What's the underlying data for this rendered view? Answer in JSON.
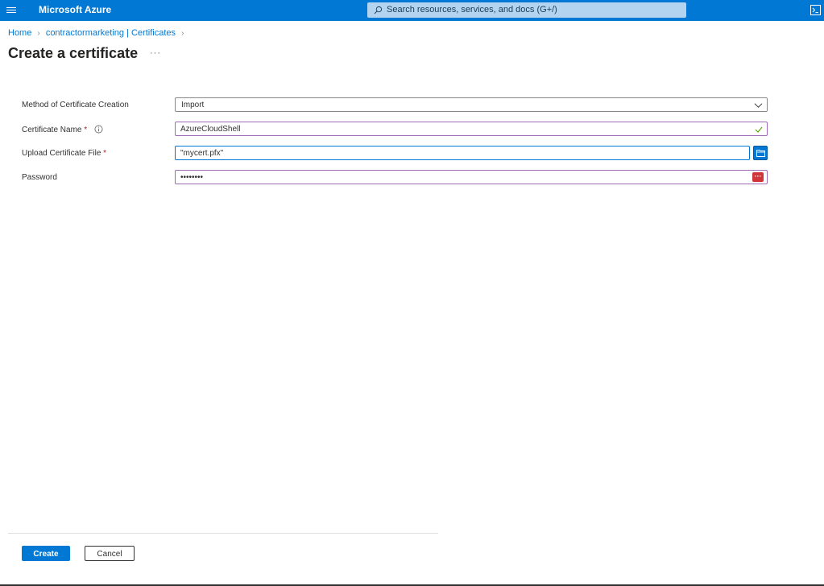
{
  "topbar": {
    "brand": "Microsoft Azure",
    "search_placeholder": "Search resources, services, and docs (G+/)",
    "color": "#0078d4"
  },
  "breadcrumb": {
    "home": "Home",
    "parent": "contractormarketing | Certificates"
  },
  "page": {
    "title": "Create a certificate",
    "more": "···"
  },
  "form": {
    "method": {
      "label": "Method of Certificate Creation",
      "value": "Import"
    },
    "name": {
      "label": "Certificate Name",
      "required_mark": "*",
      "value": "AzureCloudShell"
    },
    "upload": {
      "label": "Upload Certificate File",
      "required_mark": "*",
      "value": "\"mycert.pfx\""
    },
    "password": {
      "label": "Password",
      "value": "••••••••",
      "reveal_icon": "···"
    }
  },
  "footer": {
    "create_label": "Create",
    "cancel_label": "Cancel"
  },
  "icons": {
    "menu": "hamburger-icon",
    "search": "search-icon",
    "shell": "cloud-shell-icon",
    "info": "info-icon",
    "chevron": "chevron-down-icon",
    "check": "checkmark-icon",
    "folder": "folder-icon",
    "password": "password-manager-icon"
  }
}
